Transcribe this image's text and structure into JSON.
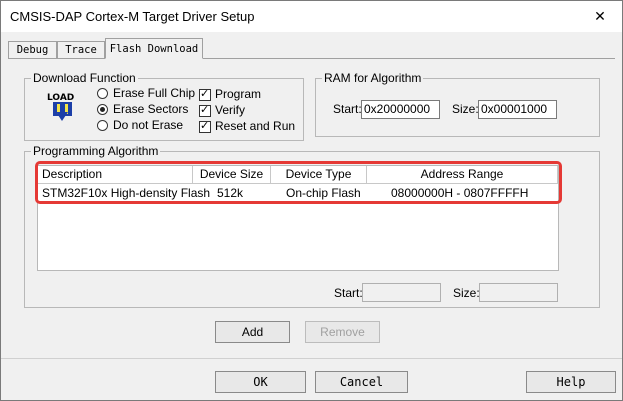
{
  "window": {
    "title": "CMSIS-DAP Cortex-M Target Driver Setup",
    "close_glyph": "✕"
  },
  "tabs": [
    {
      "label": "Debug"
    },
    {
      "label": "Trace"
    },
    {
      "label": "Flash Download"
    }
  ],
  "download_function": {
    "label": "Download Function",
    "logo_text": "LOAD",
    "radios": [
      {
        "label": "Erase Full Chip",
        "selected": false
      },
      {
        "label": "Erase Sectors",
        "selected": true
      },
      {
        "label": "Do not Erase",
        "selected": false
      }
    ],
    "checkboxes": [
      {
        "label": "Program",
        "checked": true
      },
      {
        "label": "Verify",
        "checked": true
      },
      {
        "label": "Reset and Run",
        "checked": true
      }
    ],
    "check_glyph": "✓"
  },
  "ram": {
    "label": "RAM for Algorithm",
    "start_label": "Start:",
    "start_value": "0x20000000",
    "size_label": "Size:",
    "size_value": "0x00001000"
  },
  "algorithm": {
    "label": "Programming Algorithm",
    "columns": [
      "Description",
      "Device Size",
      "Device Type",
      "Address Range"
    ],
    "rows": [
      [
        "STM32F10x High-density Flash",
        "512k",
        "On-chip Flash",
        "08000000H - 0807FFFFH"
      ]
    ],
    "start_label": "Start:",
    "size_label": "Size:",
    "start_value": "",
    "size_value": ""
  },
  "buttons": {
    "add": "Add",
    "remove": "Remove",
    "ok": "OK",
    "cancel": "Cancel",
    "help": "Help"
  }
}
